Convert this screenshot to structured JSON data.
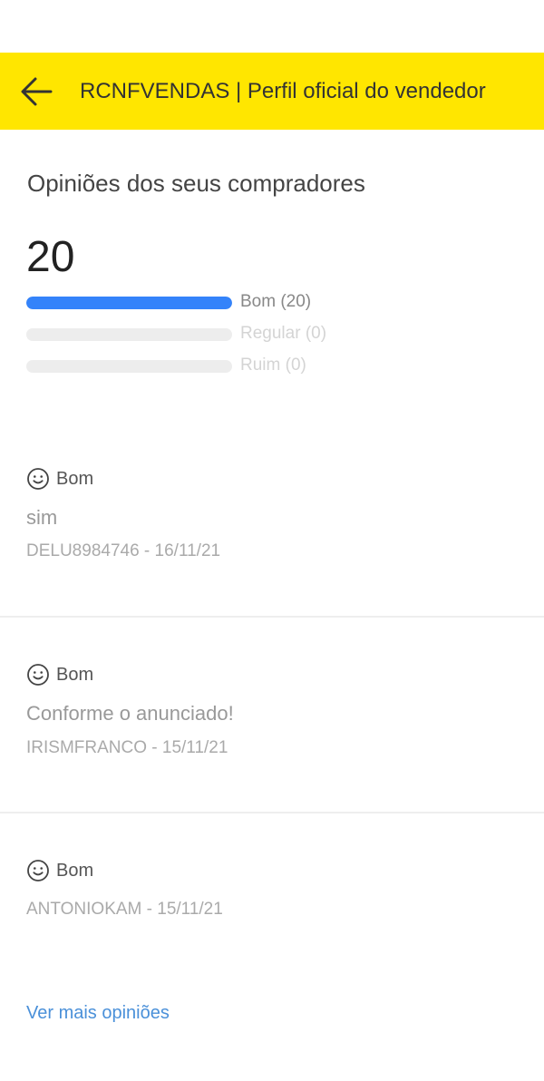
{
  "header": {
    "back_icon": "arrow-left-icon",
    "title": "RCNFVENDAS | Perfil oficial do vendedor",
    "background_color": "#ffe600"
  },
  "ratings": {
    "section_title": "Opiniões dos seus compradores",
    "total": "20",
    "accent_color": "#3483fa",
    "bars": [
      {
        "label": "Bom (20)",
        "fraction": 1.0
      },
      {
        "label": "Regular (0)",
        "fraction": 0.0
      },
      {
        "label": "Ruim (0)",
        "fraction": 0.0
      }
    ]
  },
  "reviews": [
    {
      "icon": "smiley-face-icon",
      "rating": "Bom",
      "comment": "sim",
      "meta": "DELU8984746 - 16/11/21"
    },
    {
      "icon": "smiley-face-icon",
      "rating": "Bom",
      "comment": "Conforme o anunciado!",
      "meta": "IRISMFRANCO - 15/11/21"
    },
    {
      "icon": "smiley-face-icon",
      "rating": "Bom",
      "comment": "",
      "meta": "ANTONIOKAM - 15/11/21"
    }
  ],
  "more_link": "Ver mais opiniões"
}
